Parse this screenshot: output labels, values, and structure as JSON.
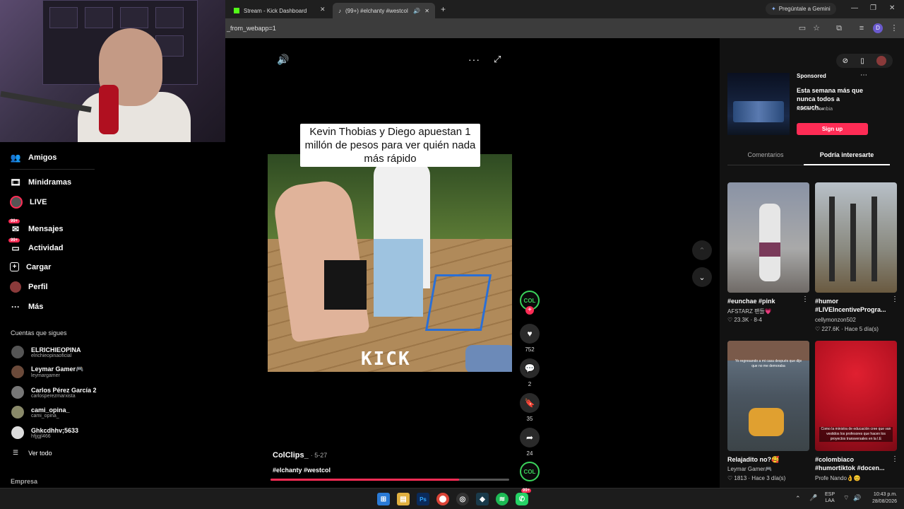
{
  "browser": {
    "tabs": [
      {
        "label": "Stream - Kick Dashboard",
        "active": false
      },
      {
        "label": "(99+) #elchanty #westcol | ",
        "active": true
      }
    ],
    "gemini_label": "Pregúntale a Gemini",
    "address": "_from_webapp=1",
    "profile_initial": "D"
  },
  "sidebar": {
    "nav": [
      {
        "label": "Amigos",
        "icon": "friends-icon"
      },
      {
        "label": "Minidramas",
        "icon": "film-icon"
      },
      {
        "label": "LIVE",
        "icon": "live-icon"
      },
      {
        "label": "Mensajes",
        "icon": "messages-icon",
        "badge": "99+"
      },
      {
        "label": "Actividad",
        "icon": "activity-icon",
        "badge": "99+"
      },
      {
        "label": "Cargar",
        "icon": "upload-icon"
      },
      {
        "label": "Perfil",
        "icon": "profile-icon"
      },
      {
        "label": "Más",
        "icon": "more-icon"
      }
    ],
    "following_title": "Cuentas que sigues",
    "following": [
      {
        "name": "ELRICHIEOPINA",
        "user": "elrichieopinaoficial"
      },
      {
        "name": "Leymar Gamer🎮",
        "user": "leymargamer"
      },
      {
        "name": "Carlos Pérez García 2",
        "user": "carlosperezmarxista"
      },
      {
        "name": "cami_opina_",
        "user": "cami_opina_"
      },
      {
        "name": "Ghkcdhhv;5633",
        "user": "hfjjgjl466"
      }
    ],
    "see_all": "Ver todo",
    "company": "Empresa"
  },
  "video": {
    "overlay_text": "Kevin Thobias y Diego apuestan 1 millón de pesos para ver quién nada más rápido",
    "watermark": "KICK",
    "author": "ColClips_",
    "date": "· 5-27",
    "hashtags": "#elchanty #westcol",
    "avatar_text": "COL",
    "likes": "752",
    "comments": "2",
    "saves": "35",
    "shares": "24",
    "progress": 0.79
  },
  "right_panel": {
    "sponsored_label": "Sponsored",
    "sponsored_title": "Esta semana más que nunca todos a escuch...",
    "sponsored_brand": "Netflix Colombia",
    "signup_label": "Sign up",
    "tabs": [
      "Comentarios",
      "Podría interesarte"
    ],
    "cards": [
      {
        "title": "#eunchae #pink",
        "user": "AFSTARZ 팬들💗",
        "stats": "♡ 23.3K · 8-4"
      },
      {
        "title": "#humor #LIVEIncentiveProgra...",
        "user": "cellymonzon502",
        "stats": "♡ 227.6K · Hace 5 día(s)"
      },
      {
        "title": "Relajadito no?🥰",
        "user": "Leymar Gamer🎮",
        "stats": "♡ 1813 · Hace 3 día(s)"
      },
      {
        "title": "#colombiaco #humortiktok #docen...",
        "user": "Profe Nando👌😊",
        "stats": ""
      }
    ],
    "card3_caption": "Yo regresando a mi casa después que dije que no me demoraba",
    "card4_caption": "Como la ministra de educación cree que van vestidos los profesores que hacen los proyectos transversales en la I.E"
  },
  "taskbar": {
    "lang": "ESP",
    "lang2": "LAA",
    "time": "10:43 p.m.",
    "date": "28/08/2026",
    "notif_badge": "99+"
  },
  "colors": {
    "accent": "#fe2c55",
    "kick_green": "#53fc18"
  }
}
